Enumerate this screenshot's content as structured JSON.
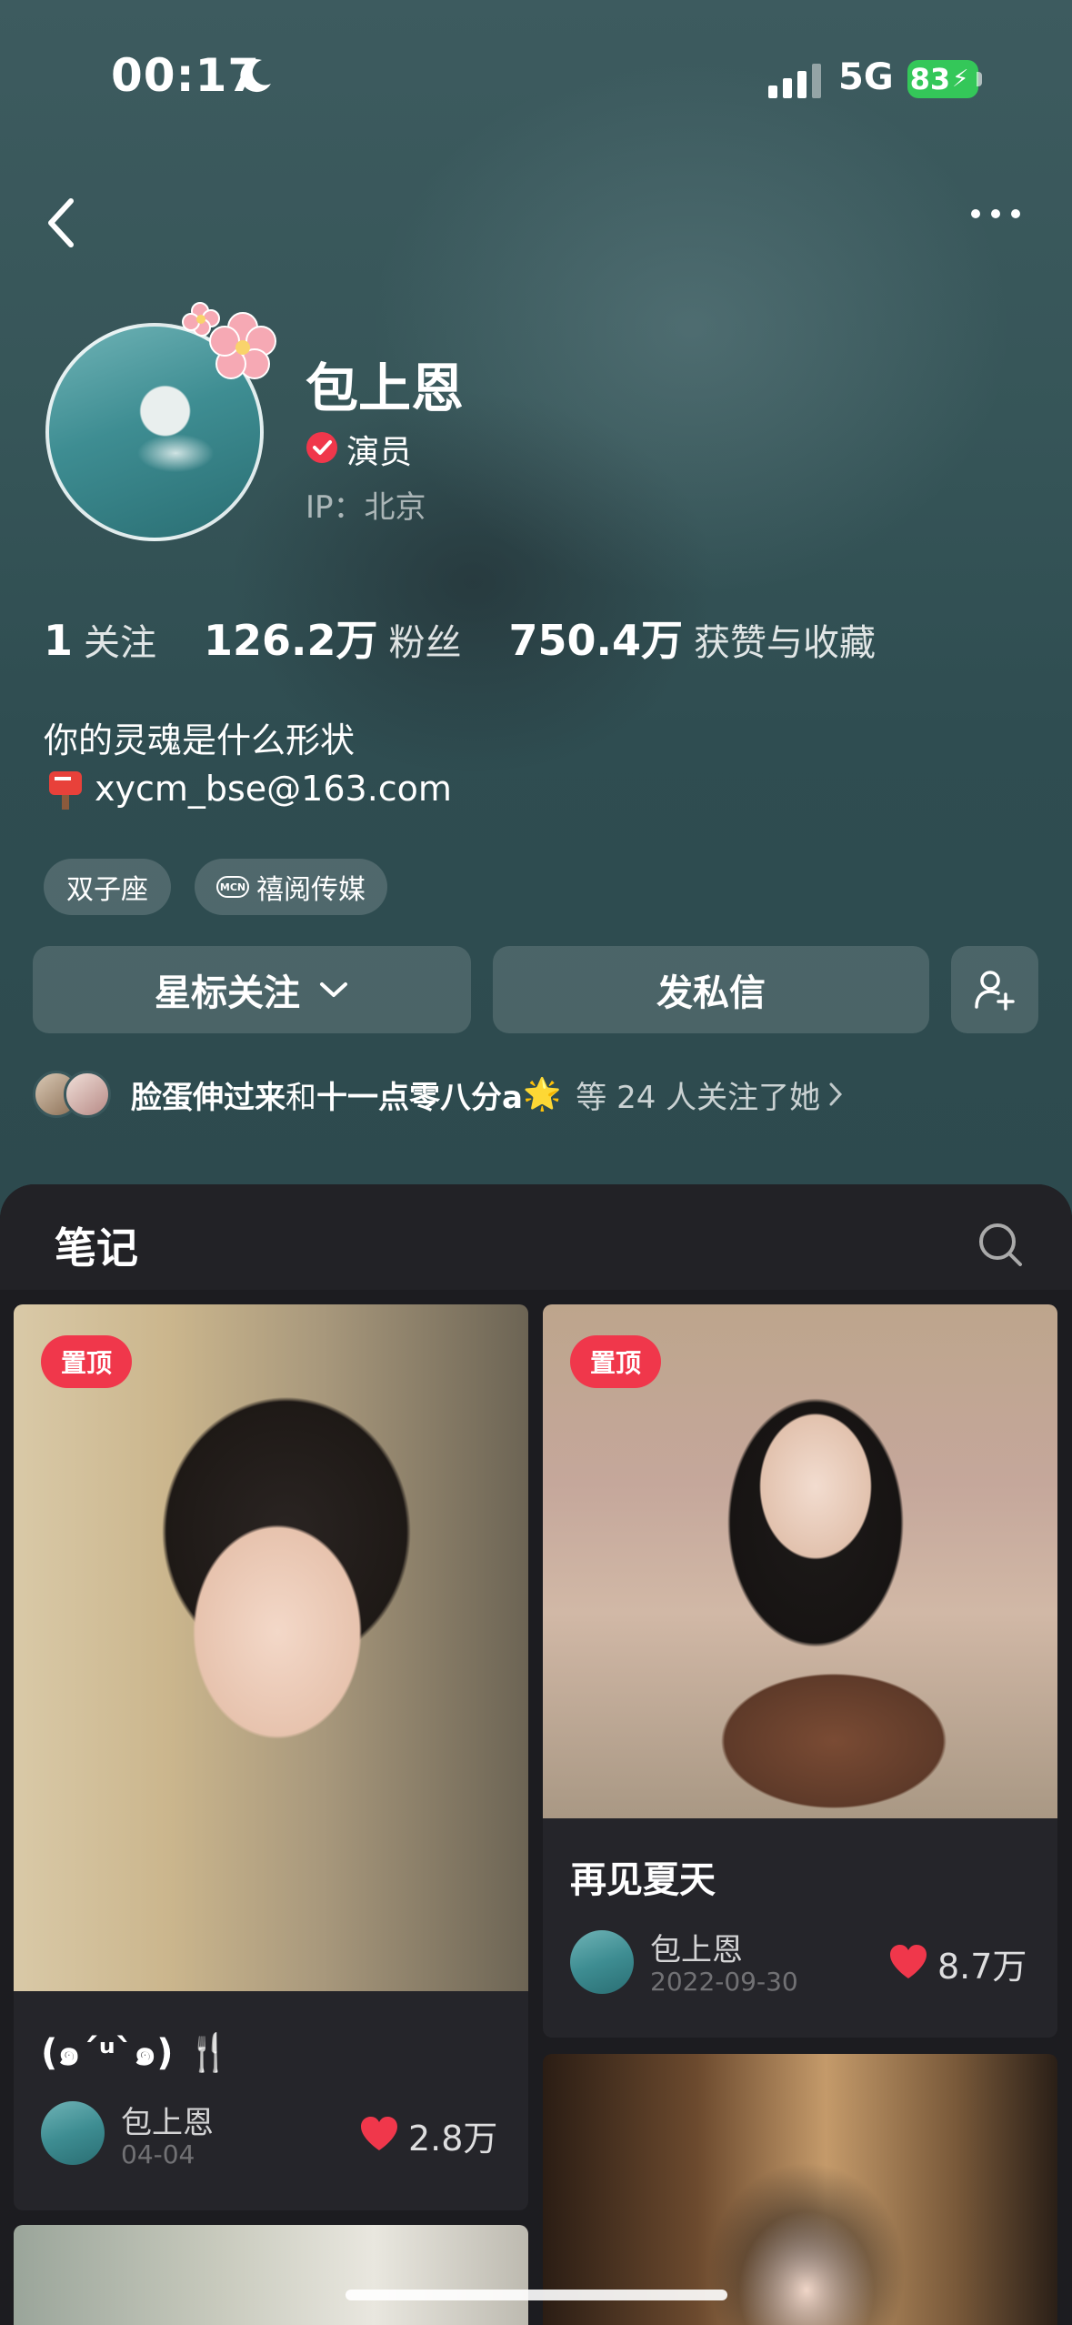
{
  "status_bar": {
    "time": "00:17",
    "network": "5G",
    "battery": "83"
  },
  "profile": {
    "name": "包上恩",
    "role": "演员",
    "ip": "IP：北京",
    "stats": [
      {
        "value": "1",
        "label": "关注"
      },
      {
        "value": "126.2万",
        "label": "粉丝"
      },
      {
        "value": "750.4万",
        "label": "获赞与收藏"
      }
    ],
    "bio_line1": "你的灵魂是什么形状",
    "bio_email": "xycm_bse@163.com",
    "tags": [
      "双子座",
      "禧阅传媒"
    ],
    "mcn_badge": "MCN"
  },
  "actions": {
    "star_follow_label": "星标关注",
    "message_label": "发私信"
  },
  "mutual": {
    "names": "脸蛋伸过来",
    "connector": "和",
    "names2": "十一点零八分a",
    "suffix": "等 24 人关注了她",
    "emoji": "🌟"
  },
  "notes": {
    "title": "笔记",
    "pinned_label": "置顶",
    "cards": [
      {
        "title": "(๑´ᵘ`๑) 🍴",
        "author": "包上恩",
        "date": "04-04",
        "likes": "2.8万"
      },
      {
        "title": "再见夏天",
        "author": "包上恩",
        "date": "2022-09-30",
        "likes": "8.7万"
      }
    ]
  },
  "icons": {
    "back": "chevron-left-icon",
    "more": "more-dots-icon",
    "search": "search-icon",
    "add_friend": "add-user-icon",
    "heart": "heart-icon"
  },
  "colors": {
    "accent": "#f0374b",
    "battery": "#34c759",
    "panel": "#1c1c20"
  }
}
